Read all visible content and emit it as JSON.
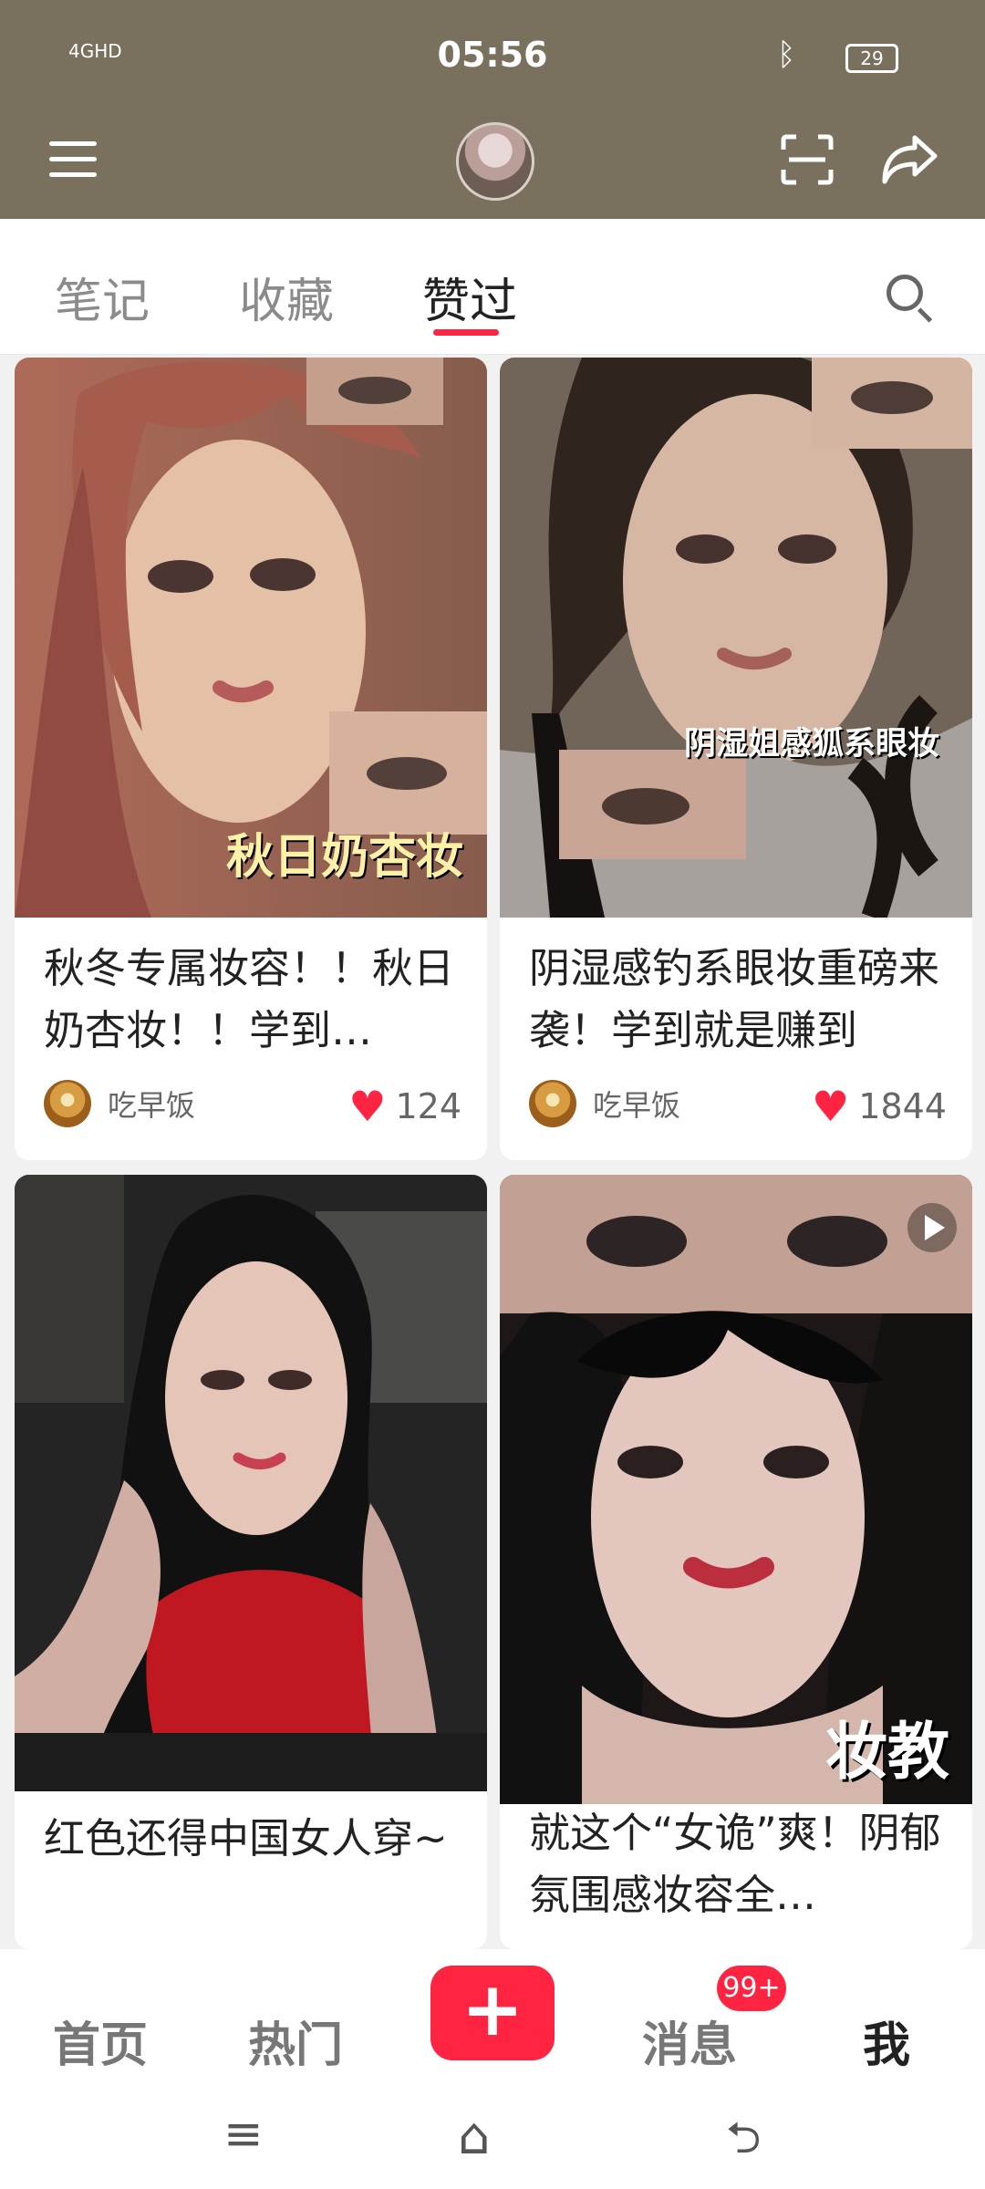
{
  "status": {
    "time": "05:56",
    "network": "4GHD",
    "battery": "29"
  },
  "tabs": [
    "笔记",
    "收藏",
    "赞过"
  ],
  "cards": [
    {
      "title": "秋冬专属妆容！！秋日奶杏妆！！学到…",
      "author": "吃早饭",
      "likes": "124",
      "overlay": "秋日奶杏妆"
    },
    {
      "title": "阴湿感钓系眼妆重磅来袭！学到就是赚到",
      "author": "吃早饭",
      "likes": "1844",
      "overlay": "阴湿姐感狐系眼妆"
    },
    {
      "title": "红色还得中国女人穿~",
      "author": "",
      "likes": "",
      "overlay": ""
    },
    {
      "title": "就这个“女诡”爽！阴郁氛围感妆容全…",
      "author": "",
      "likes": "",
      "overlay": "妆教"
    }
  ],
  "nav": {
    "home": "首页",
    "hot": "热门",
    "add": "+",
    "messages": "消息",
    "messages_badge": "99+",
    "me": "我"
  }
}
